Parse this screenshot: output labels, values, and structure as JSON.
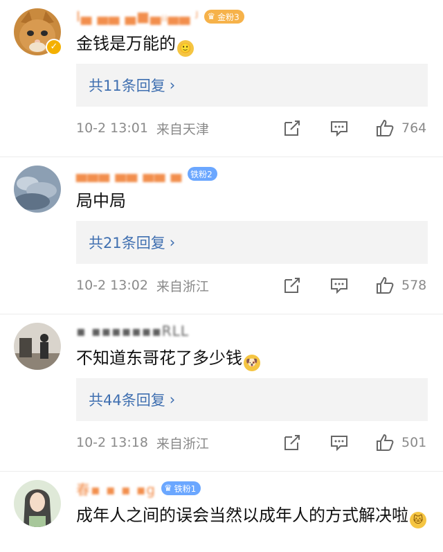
{
  "comments": [
    {
      "username": "I▄ ▄▄ ▄■▄ᵢᵢ▄▄ ᴶ",
      "badge": "金粉3",
      "text": "金钱是万能的",
      "emoji": "🙂",
      "reply_label": "共11条回复",
      "time": "10-2 13:01",
      "source": "来自天津",
      "likes": "764",
      "verified": true
    },
    {
      "username": "▄▄▄ ▄▄ ▄▄ ▄",
      "badge": "铁粉2",
      "text": "局中局",
      "emoji": "",
      "reply_label": "共21条回复",
      "time": "10-2 13:02",
      "source": "来自浙江",
      "likes": "578",
      "verified": false
    },
    {
      "username": "▪ ▪▪▪▪▪▪▪RLL",
      "badge": "",
      "text": "不知道东哥花了多少钱",
      "emoji": "🐶",
      "reply_label": "共44条回复",
      "time": "10-2 13:18",
      "source": "来自浙江",
      "likes": "501",
      "verified": false
    },
    {
      "username": "春▪ ▪ ▪ ▪g",
      "badge": "铁粉1",
      "text": "成年人之间的误会当然以成年人的方式解决啦",
      "emoji": "🐱"
    }
  ]
}
